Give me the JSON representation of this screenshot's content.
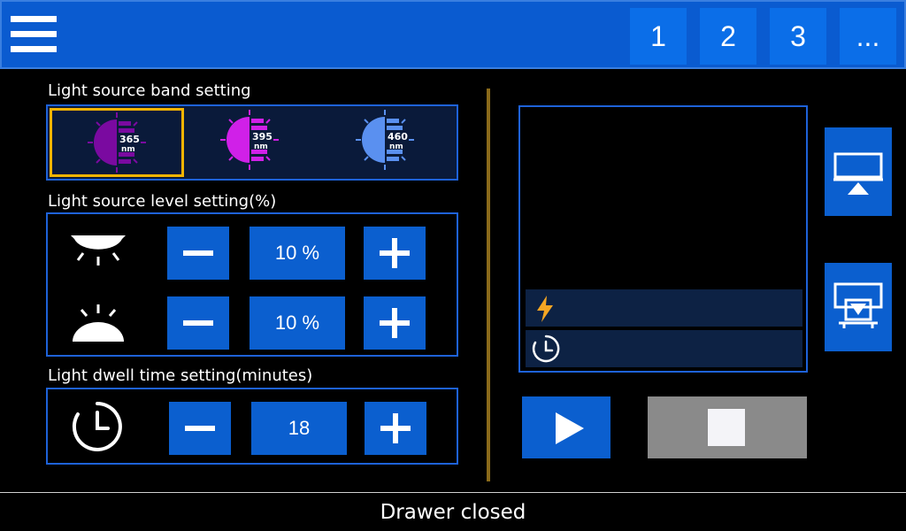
{
  "header": {
    "tabs": [
      {
        "label": "1"
      },
      {
        "label": "2"
      },
      {
        "label": "3"
      },
      {
        "label": "..."
      }
    ]
  },
  "band_section": {
    "title": "Light source band setting",
    "bands": [
      {
        "wavelength": "365",
        "unit": "nm",
        "color": "#7a0aa0",
        "selected": true
      },
      {
        "wavelength": "395",
        "unit": "nm",
        "color": "#d020e8",
        "selected": false
      },
      {
        "wavelength": "460",
        "unit": "nm",
        "color": "#5a90f0",
        "selected": false
      }
    ]
  },
  "level_section": {
    "title": "Light source level setting(%)",
    "top_light": {
      "value": "10 %"
    },
    "bottom_light": {
      "value": "10 %"
    }
  },
  "dwell_section": {
    "title": "Light dwell time setting(minutes)",
    "value": "18"
  },
  "status": {
    "text": "Drawer closed"
  },
  "colors": {
    "accent_blue": "#0b5fcf",
    "selection": "#f5b400",
    "power_icon": "#f5a623",
    "stop_bg": "#8a8a8a"
  }
}
